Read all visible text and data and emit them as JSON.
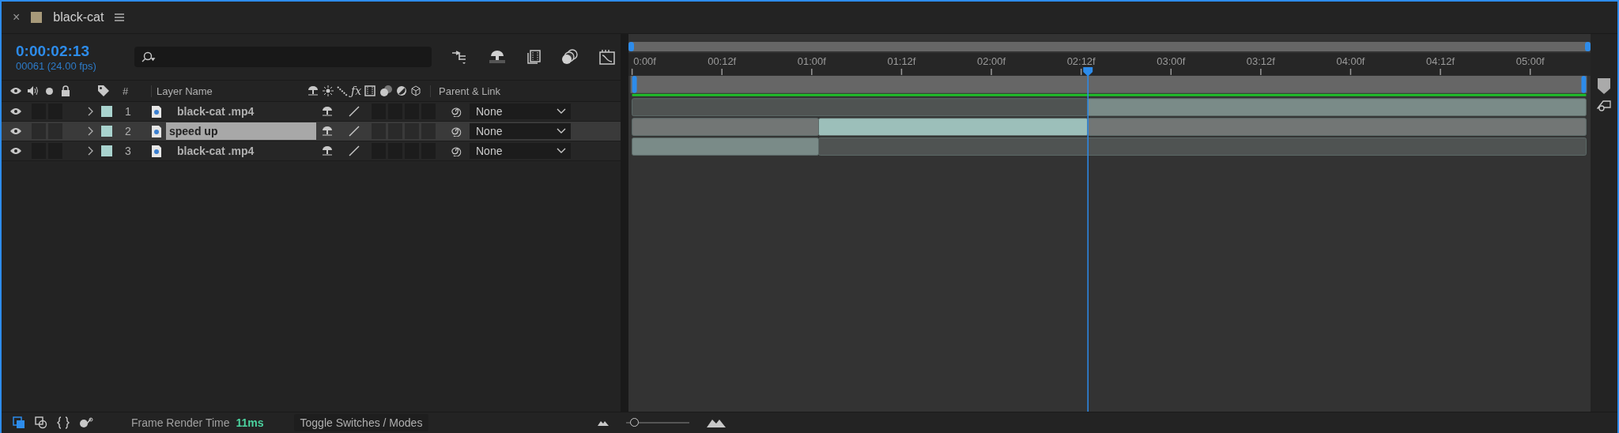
{
  "tab": {
    "close": "×",
    "title": "black-cat"
  },
  "timecode": "0:00:02:13",
  "frame_info": "00061 (24.00 fps)",
  "columns": {
    "number": "#",
    "name": "Layer Name",
    "effects": "ƒx",
    "parent": "Parent & Link"
  },
  "layers": [
    {
      "index": "1",
      "name": "black-cat .mp4",
      "selected": false,
      "editing": false,
      "color": "#a9d3ce",
      "parent": "None"
    },
    {
      "index": "2",
      "name": "speed up",
      "selected": true,
      "editing": true,
      "color": "#a9d3ce",
      "parent": "None"
    },
    {
      "index": "3",
      "name": "black-cat .mp4",
      "selected": false,
      "editing": false,
      "color": "#a9d3ce",
      "parent": "None"
    }
  ],
  "timeline": {
    "ruler": [
      "0:00f",
      "00:12f",
      "01:00f",
      "01:12f",
      "02:00f",
      "02:12f",
      "03:00f",
      "03:12f",
      "04:00f",
      "04:12f",
      "05:00f"
    ],
    "playhead": {
      "level": 0.4778
    },
    "tracks": [
      [
        {
          "kind": "dim",
          "level": 0.4774
        },
        {
          "kind": "light",
          "level": 0.5226
        }
      ],
      [
        {
          "kind": "gray",
          "level": 0.1955
        },
        {
          "kind": "teal",
          "level": 0.282
        },
        {
          "kind": "gray",
          "level": 0.5225
        }
      ],
      [
        {
          "kind": "light",
          "level": 0.1955
        },
        {
          "kind": "dim",
          "level": 0.8045
        }
      ]
    ]
  },
  "status": {
    "label": "Frame Render Time",
    "value": "11ms",
    "toggle": "Toggle Switches / Modes",
    "zoom": {
      "level": 0.05
    }
  }
}
